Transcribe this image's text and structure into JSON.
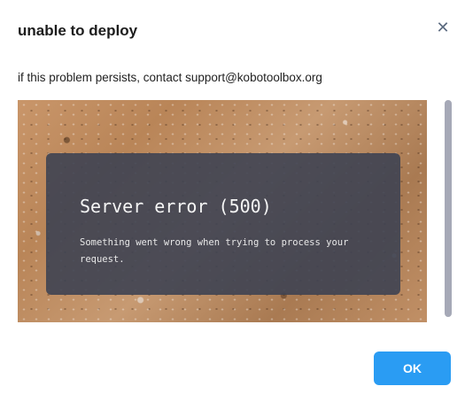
{
  "dialog": {
    "title": "unable to deploy",
    "close_icon": "close-icon",
    "message": "if this problem persists, contact support@kobotoolbox.org",
    "error": {
      "title": "Server error (500)",
      "detail": "Something went wrong when trying to process your request."
    },
    "ok_label": "OK"
  },
  "colors": {
    "accent": "#2a9cf3",
    "error_card": "#3e4252",
    "scrollbar": "#a6a9b7"
  }
}
